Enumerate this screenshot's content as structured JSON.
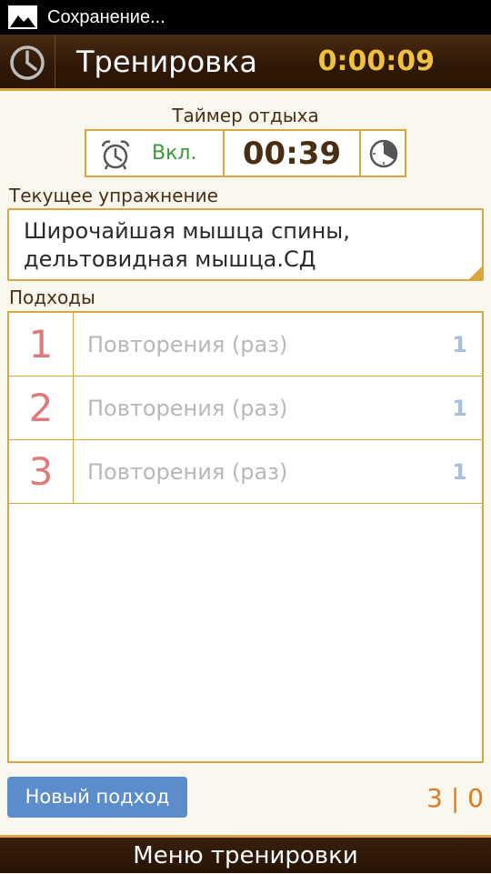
{
  "status_bar": {
    "text": "Сохранение..."
  },
  "header": {
    "title": "Тренировка",
    "elapsed": "0:00:09"
  },
  "rest_timer": {
    "label": "Таймер отдыха",
    "state": "Вкл.",
    "time": "00:39"
  },
  "exercise": {
    "label": "Текущее упражнение",
    "name": "Широчайшая мышца спины, дельтовидная мышца.СД"
  },
  "sets": {
    "label": "Подходы",
    "rows": [
      {
        "number": "1",
        "placeholder": "Повторения (раз)",
        "count": "1"
      },
      {
        "number": "2",
        "placeholder": "Повторения (раз)",
        "count": "1"
      },
      {
        "number": "3",
        "placeholder": "Повторения (раз)",
        "count": "1"
      }
    ]
  },
  "actions": {
    "new_set_label": "Новый подход",
    "counter": "3 | 0"
  },
  "bottom_bar": {
    "label": "Меню тренировки"
  },
  "colors": {
    "accent": "#d9a640",
    "header_bg": "#2e1808",
    "button": "#5b8dcc",
    "set_number": "#e07a7a",
    "counter": "#e07a20",
    "on_state": "#3a9a3a"
  }
}
